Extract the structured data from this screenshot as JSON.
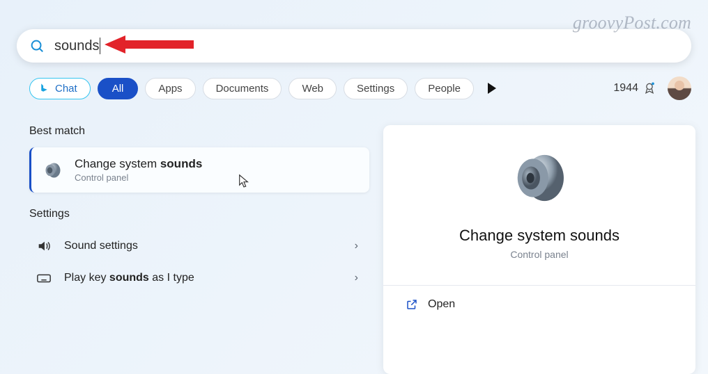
{
  "watermark": "groovyPost.com",
  "search": {
    "value": "sounds"
  },
  "filters": {
    "chat": "Chat",
    "all": "All",
    "apps": "Apps",
    "documents": "Documents",
    "web": "Web",
    "settings": "Settings",
    "people": "People"
  },
  "rewards": {
    "points": "1944"
  },
  "results": {
    "best_match_label": "Best match",
    "best_match": {
      "title_prefix": "Change system ",
      "title_bold": "sounds",
      "subtitle": "Control panel"
    },
    "settings_label": "Settings",
    "rows": [
      {
        "label": "Sound settings",
        "bold": ""
      },
      {
        "label_prefix": "Play key ",
        "bold": "sounds",
        "label_suffix": " as I type"
      }
    ]
  },
  "detail": {
    "title": "Change system sounds",
    "subtitle": "Control panel",
    "open": "Open"
  }
}
